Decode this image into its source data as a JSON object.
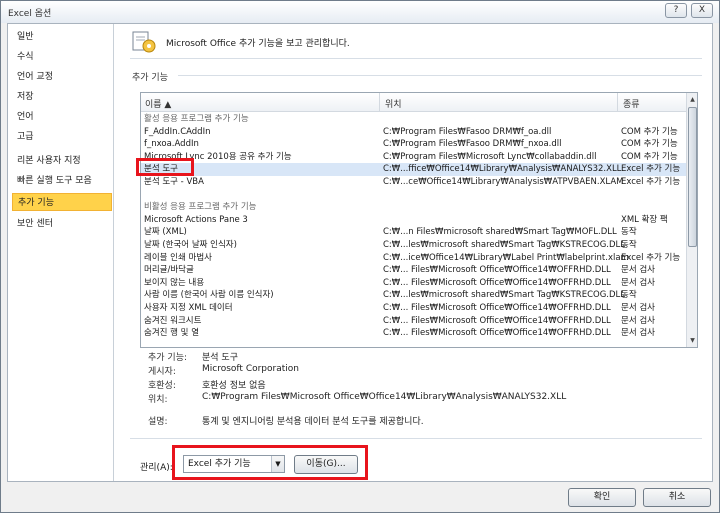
{
  "window": {
    "title": "Excel 옵션",
    "help_button": "?",
    "close_button": "X"
  },
  "nav": {
    "items": [
      {
        "label": "일반"
      },
      {
        "label": "수식"
      },
      {
        "label": "언어 교정"
      },
      {
        "label": "저장"
      },
      {
        "label": "언어"
      },
      {
        "label": "고급"
      },
      {
        "label": "리본 사용자 지정"
      },
      {
        "label": "빠른 실행 도구 모음"
      },
      {
        "label": "추가 기능"
      },
      {
        "label": "보안 센터"
      }
    ],
    "active_index": 8
  },
  "header": {
    "title": "Microsoft Office 추가 기능을 보고 관리합니다."
  },
  "section": {
    "label": "추가 기능"
  },
  "list": {
    "columns": [
      "이름 ▲",
      "위치",
      "종류"
    ],
    "rows": [
      {
        "name": "활성 응용 프로그램 추가 기능",
        "location": "",
        "type": "",
        "group": true
      },
      {
        "name": "F_AddIn.CAddIn",
        "location": "C:₩Program Files₩Fasoo DRM₩f_oa.dll",
        "type": "COM 추가 기능"
      },
      {
        "name": "f_nxoa.AddIn",
        "location": "C:₩Program Files₩Fasoo DRM₩f_nxoa.dll",
        "type": "COM 추가 기능"
      },
      {
        "name": "Microsoft Lync 2010용 공유 추가 기능",
        "location": "C:₩Program Files₩Microsoft Lync₩collabaddin.dll",
        "type": "COM 추가 기능"
      },
      {
        "name": "분석 도구",
        "location": "C:₩...ffice₩Office14₩Library₩Analysis₩ANALYS32.XLL",
        "type": "Excel 추가 기능",
        "selected": true
      },
      {
        "name": "분석 도구 - VBA",
        "location": "C:₩...ce₩Office14₩Library₩Analysis₩ATPVBAEN.XLAM",
        "type": "Excel 추가 기능"
      },
      {
        "name": "",
        "location": "",
        "type": ""
      },
      {
        "name": "비활성 응용 프로그램 추가 기능",
        "location": "",
        "type": "",
        "group": true
      },
      {
        "name": "Microsoft Actions Pane 3",
        "location": "",
        "type": "XML 확장 팩"
      },
      {
        "name": "날짜 (XML)",
        "location": "C:₩...n Files₩microsoft shared₩Smart Tag₩MOFL.DLL",
        "type": "동작"
      },
      {
        "name": "날짜 (한국어 날짜 인식자)",
        "location": "C:₩...les₩microsoft shared₩Smart Tag₩KSTRECOG.DLL",
        "type": "동작"
      },
      {
        "name": "레이블 인쇄 마법사",
        "location": "C:₩...ice₩Office14₩Library₩Label Print₩labelprint.xlam",
        "type": "Excel 추가 기능"
      },
      {
        "name": "머리글/바닥글",
        "location": "C:₩... Files₩Microsoft Office₩Office14₩OFFRHD.DLL",
        "type": "문서 검사"
      },
      {
        "name": "보이지 않는 내용",
        "location": "C:₩... Files₩Microsoft Office₩Office14₩OFFRHD.DLL",
        "type": "문서 검사"
      },
      {
        "name": "사람 이름 (한국어 사람 이름 인식자)",
        "location": "C:₩...les₩microsoft shared₩Smart Tag₩KSTRECOG.DLL",
        "type": "동작"
      },
      {
        "name": "사용자 지정 XML 데이터",
        "location": "C:₩... Files₩Microsoft Office₩Office14₩OFFRHD.DLL",
        "type": "문서 검사"
      },
      {
        "name": "숨겨진 워크시트",
        "location": "C:₩... Files₩Microsoft Office₩Office14₩OFFRHD.DLL",
        "type": "문서 검사"
      },
      {
        "name": "숨겨진 행 및 열",
        "location": "C:₩... Files₩Microsoft Office₩Office14₩OFFRHD.DLL",
        "type": "문서 검사"
      }
    ]
  },
  "details": {
    "addin_key": "추가 기능:",
    "addin_val": "분석 도구",
    "publisher_key": "게시자:",
    "publisher_val": "Microsoft Corporation",
    "compat_key": "호환성:",
    "compat_val": "호환성 정보 없음",
    "location_key": "위치:",
    "location_val": "C:₩Program Files₩Microsoft Office₩Office14₩Library₩Analysis₩ANALYS32.XLL",
    "desc_key": "설명:",
    "desc_val": "통계 및 엔지니어링 분석용 데이터 분석 도구를 제공합니다."
  },
  "manage": {
    "label": "관리(A):",
    "selected": "Excel 추가 기능",
    "go_button": "이동(G)..."
  },
  "footer": {
    "ok": "확인",
    "cancel": "취소"
  },
  "colors": {
    "highlight_red": "#e8141c",
    "active_nav": "#ffd24a"
  }
}
